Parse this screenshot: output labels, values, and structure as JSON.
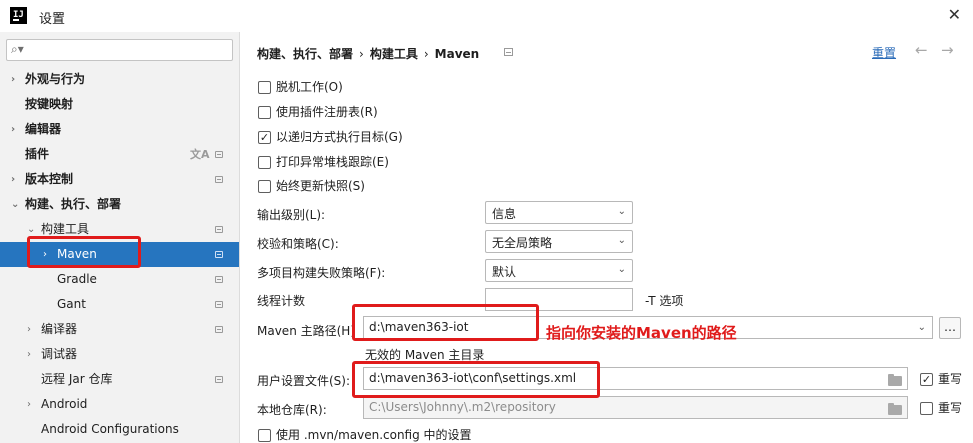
{
  "window": {
    "title": "设置"
  },
  "sidebar": {
    "search_placeholder": "",
    "items": [
      {
        "label": "外观与行为"
      },
      {
        "label": "按键映射"
      },
      {
        "label": "编辑器"
      },
      {
        "label": "插件"
      },
      {
        "label": "版本控制"
      },
      {
        "label": "构建、执行、部署"
      },
      {
        "label": "构建工具"
      },
      {
        "label": "Maven"
      },
      {
        "label": "Gradle"
      },
      {
        "label": "Gant"
      },
      {
        "label": "编译器"
      },
      {
        "label": "调试器"
      },
      {
        "label": "远程 Jar 仓库"
      },
      {
        "label": "Android"
      },
      {
        "label": "Android Configurations"
      }
    ]
  },
  "header": {
    "breadcrumb": [
      "构建、执行、部署",
      "构建工具",
      "Maven"
    ],
    "separator": "›",
    "reset_label": "重置"
  },
  "checkboxes": [
    {
      "label": "脱机工作(O)",
      "checked": false
    },
    {
      "label": "使用插件注册表(R)",
      "checked": false
    },
    {
      "label": "以递归方式执行目标(G)",
      "checked": true
    },
    {
      "label": "打印异常堆栈跟踪(E)",
      "checked": false
    },
    {
      "label": "始终更新快照(S)",
      "checked": false
    }
  ],
  "fields": {
    "output_level_label": "输出级别(L):",
    "output_level_value": "信息",
    "checksum_label": "校验和策略(C):",
    "checksum_value": "无全局策略",
    "multiproject_label": "多项目构建失败策略(F):",
    "multiproject_value": "默认",
    "threads_label": "线程计数",
    "threads_value": "",
    "threads_hint": "-T 选项",
    "maven_home_label": "Maven 主路径(H)",
    "maven_home_value": "d:\\maven363-iot",
    "maven_home_hint": "无效的 Maven 主目录",
    "user_settings_label": "用户设置文件(S):",
    "user_settings_value": "d:\\maven363-iot\\conf\\settings.xml",
    "user_settings_override_label": "重写",
    "user_settings_override_checked": true,
    "local_repo_label": "本地仓库(R):",
    "local_repo_value": "C:\\Users\\Johnny\\.m2\\repository",
    "local_repo_override_label": "重写",
    "local_repo_override_checked": false,
    "use_mvn_config_label": "使用 .mvn/maven.config 中的设置",
    "use_mvn_config_checked": false
  },
  "annotation": {
    "text": "指向你安装的Maven的路径",
    "color": "#e01b1b"
  },
  "colors": {
    "selection": "#2675bf",
    "link": "#2a6bb8",
    "annotation": "#e01b1b"
  }
}
